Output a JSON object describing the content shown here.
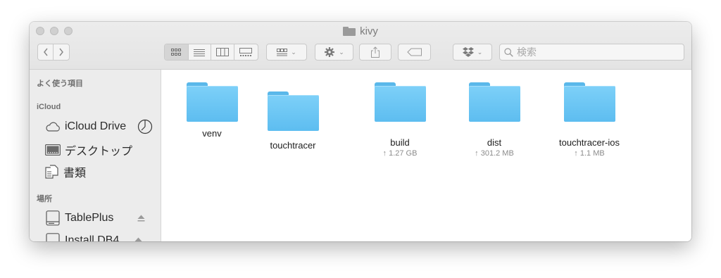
{
  "window": {
    "title": "kivy",
    "search_placeholder": "検索"
  },
  "toolbar": {
    "back": "‹",
    "forward": "›"
  },
  "sidebar": {
    "favorites_heading": "よく使う項目",
    "icloud_heading": "iCloud",
    "icloud_drive": "iCloud Drive",
    "desktop": "デスクトップ",
    "documents": "書類",
    "locations_heading": "場所",
    "tableplus": "TablePlus",
    "install": "Install DB4"
  },
  "files": [
    {
      "name": "venv",
      "size": ""
    },
    {
      "name": "touchtracer",
      "size": ""
    },
    {
      "name": "build",
      "size": "↑ 1.27 GB"
    },
    {
      "name": "dist",
      "size": "↑ 301.2 MB"
    },
    {
      "name": "touchtracer-ios",
      "size": "↑ 1.1 MB"
    }
  ],
  "colors": {
    "folder": "#6cc7f5",
    "sidebar_bg": "#ececec",
    "toolbar_bg": "#e8e8e8"
  }
}
